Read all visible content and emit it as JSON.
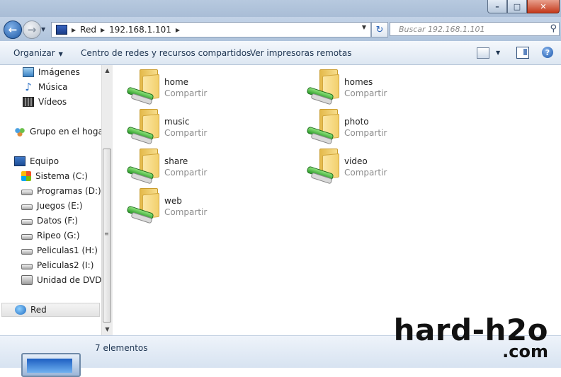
{
  "window": {
    "buttons": {
      "minimize": "–",
      "maximize": "□",
      "close": "✕"
    }
  },
  "navigation": {
    "back_icon": "back-arrow-icon",
    "forward_icon": "forward-arrow-icon",
    "breadcrumb": [
      "Red",
      "192.168.1.101"
    ],
    "search_placeholder": "Buscar 192.168.1.101"
  },
  "toolbar": {
    "organize": "Organizar",
    "network_center": "Centro de redes y recursos compartidos",
    "remote_printers": "Ver impresoras remotas",
    "help": "?"
  },
  "sidebar": {
    "items": [
      {
        "label": "Imágenes",
        "icon": "pictures-icon"
      },
      {
        "label": "Música",
        "icon": "music-icon"
      },
      {
        "label": "Vídeos",
        "icon": "videos-icon"
      },
      {
        "label": "Grupo en el hogar",
        "icon": "homegroup-icon"
      },
      {
        "label": "Equipo",
        "icon": "computer-icon"
      },
      {
        "label": "Sistema (C:)",
        "icon": "system-drive-icon"
      },
      {
        "label": "Programas (D:)",
        "icon": "drive-icon"
      },
      {
        "label": "Juegos (E:)",
        "icon": "drive-icon"
      },
      {
        "label": "Datos (F:)",
        "icon": "drive-icon"
      },
      {
        "label": "Ripeo (G:)",
        "icon": "drive-icon"
      },
      {
        "label": "Peliculas1 (H:)",
        "icon": "drive-icon"
      },
      {
        "label": "Peliculas2 (I:)",
        "icon": "drive-icon"
      },
      {
        "label": "Unidad de DVD R",
        "icon": "dvd-drive-icon"
      },
      {
        "label": "Red",
        "icon": "network-icon",
        "selected": true
      }
    ]
  },
  "shares": [
    {
      "name": "home",
      "type": "Compartir"
    },
    {
      "name": "homes",
      "type": "Compartir"
    },
    {
      "name": "music",
      "type": "Compartir"
    },
    {
      "name": "photo",
      "type": "Compartir"
    },
    {
      "name": "share",
      "type": "Compartir"
    },
    {
      "name": "video",
      "type": "Compartir"
    },
    {
      "name": "web",
      "type": "Compartir"
    }
  ],
  "status": {
    "count": "7 elementos"
  },
  "watermark": {
    "line1": "hard-h2o",
    "line2": ".com"
  }
}
